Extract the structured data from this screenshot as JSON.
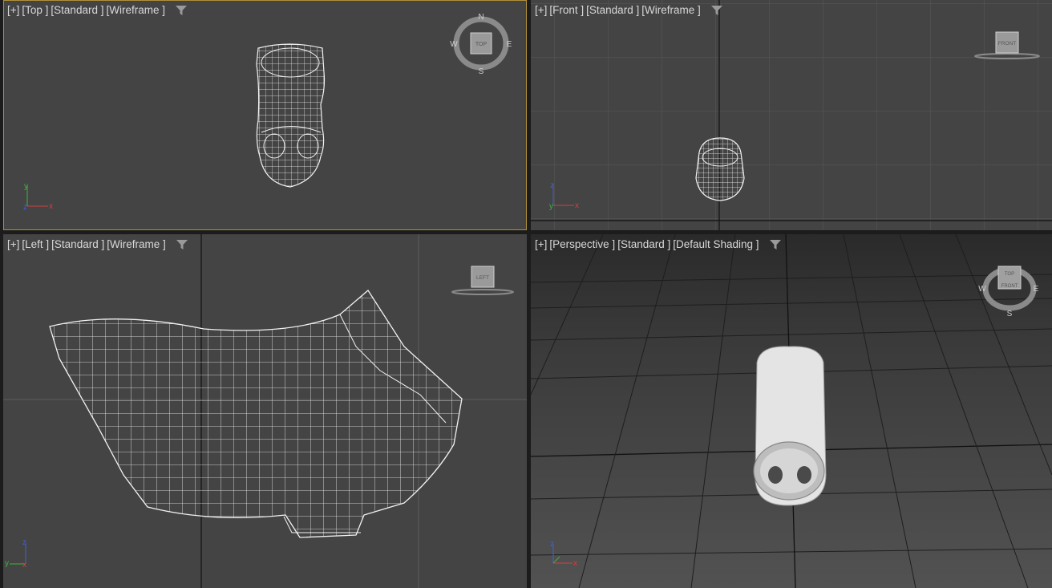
{
  "viewports": {
    "top": {
      "plus": "[+]",
      "view": "[Top ]",
      "preset": "[Standard ]",
      "mode": "[Wireframe ]"
    },
    "front": {
      "plus": "[+]",
      "view": "[Front ]",
      "preset": "[Standard ]",
      "mode": "[Wireframe ]"
    },
    "left": {
      "plus": "[+]",
      "view": "[Left ]",
      "preset": "[Standard ]",
      "mode": "[Wireframe ]"
    },
    "perspective": {
      "plus": "[+]",
      "view": "[Perspective ]",
      "preset": "[Standard ]",
      "mode": "[Default Shading ]"
    }
  },
  "viewcube": {
    "top_label": "TOP",
    "front_label": "FRONT",
    "left_label": "LEFT",
    "compass_n": "N",
    "compass_s": "S",
    "compass_e": "E",
    "compass_w": "W"
  },
  "axes": {
    "x": "x",
    "y": "y",
    "z": "z"
  },
  "colors": {
    "active_border": "#b0903a",
    "wire": "#f2f2f2",
    "grid": "#555555",
    "axis_x": "#d04040",
    "axis_y": "#40b040",
    "axis_z": "#4060d0"
  }
}
